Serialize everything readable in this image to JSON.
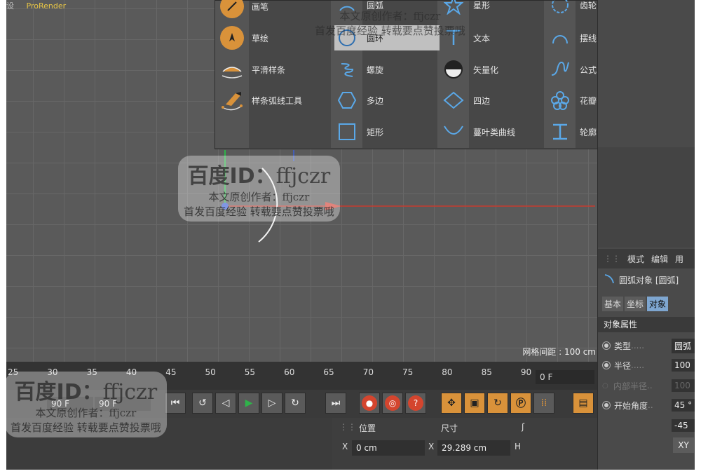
{
  "menu": {
    "item1": "设",
    "item2": "ProRender"
  },
  "popup": {
    "col1": [
      {
        "label": "画笔",
        "icon": "pen-brush-icon"
      },
      {
        "label": "草绘",
        "icon": "sketch-icon"
      },
      {
        "label": "平滑样条",
        "icon": "smooth-spline-icon"
      },
      {
        "label": "样条弧线工具",
        "icon": "spline-arc-tool-icon"
      }
    ],
    "col2": [
      {
        "label": "圆弧",
        "icon": "arc-icon"
      },
      {
        "label": "圆环",
        "icon": "circle-icon"
      },
      {
        "label": "螺旋",
        "icon": "helix-icon"
      },
      {
        "label": "多边",
        "icon": "polygon-icon"
      },
      {
        "label": "矩形",
        "icon": "rectangle-icon"
      }
    ],
    "col3": [
      {
        "label": "星形",
        "icon": "star-icon"
      },
      {
        "label": "文本",
        "icon": "text-icon"
      },
      {
        "label": "矢量化",
        "icon": "vectorizer-icon"
      },
      {
        "label": "四边",
        "icon": "four-side-icon"
      },
      {
        "label": "蔓叶类曲线",
        "icon": "cissoid-icon"
      }
    ],
    "col4": [
      {
        "label": "齿轮",
        "icon": "cog-wheel-icon"
      },
      {
        "label": "摆线",
        "icon": "cycloid-icon"
      },
      {
        "label": "公式",
        "icon": "formula-icon"
      },
      {
        "label": "花瓣",
        "icon": "flower-icon"
      },
      {
        "label": "轮廓",
        "icon": "profile-icon"
      }
    ]
  },
  "viewport": {
    "grid_label": "网格间距 : 100 cm"
  },
  "attributes": {
    "menu": [
      "模式",
      "编辑",
      "用"
    ],
    "object_title": "圆弧对象 [圆弧]",
    "tabs": [
      "基本",
      "坐标",
      "对象"
    ],
    "section": "对象属性",
    "props": [
      {
        "label": "类型",
        "value": "圆弧"
      },
      {
        "label": "半径",
        "value": "100"
      },
      {
        "label": "内部半径",
        "value": "100"
      },
      {
        "label": "开始角度",
        "value": "45 °"
      }
    ],
    "extra_value": "-45",
    "xy_button": "XY"
  },
  "timeline": {
    "ticks": [
      "25",
      "30",
      "35",
      "40",
      "45",
      "50",
      "55",
      "60",
      "65",
      "70",
      "75",
      "80",
      "85",
      "90"
    ],
    "current_frame": "0 F",
    "end_frame": "90 F",
    "start_frame": "90 F"
  },
  "coords": {
    "position_label": "位置",
    "size_label": "尺寸",
    "x_label": "X",
    "x_pos": "0 cm",
    "x_size": "29.289 cm",
    "h_label": "H"
  },
  "watermark": {
    "line1": "百度ID：",
    "id": "ffjczr",
    "line2": "本文原创作者：ffjczr",
    "line3": "首发百度经验 转载要点赞投票哦"
  },
  "colors": {
    "accent": "#d9923a",
    "x_axis": "#c83a2e",
    "y_axis": "#2fb24a",
    "z_axis": "#3d5fd6",
    "icon_blue": "#5aa8e8"
  }
}
